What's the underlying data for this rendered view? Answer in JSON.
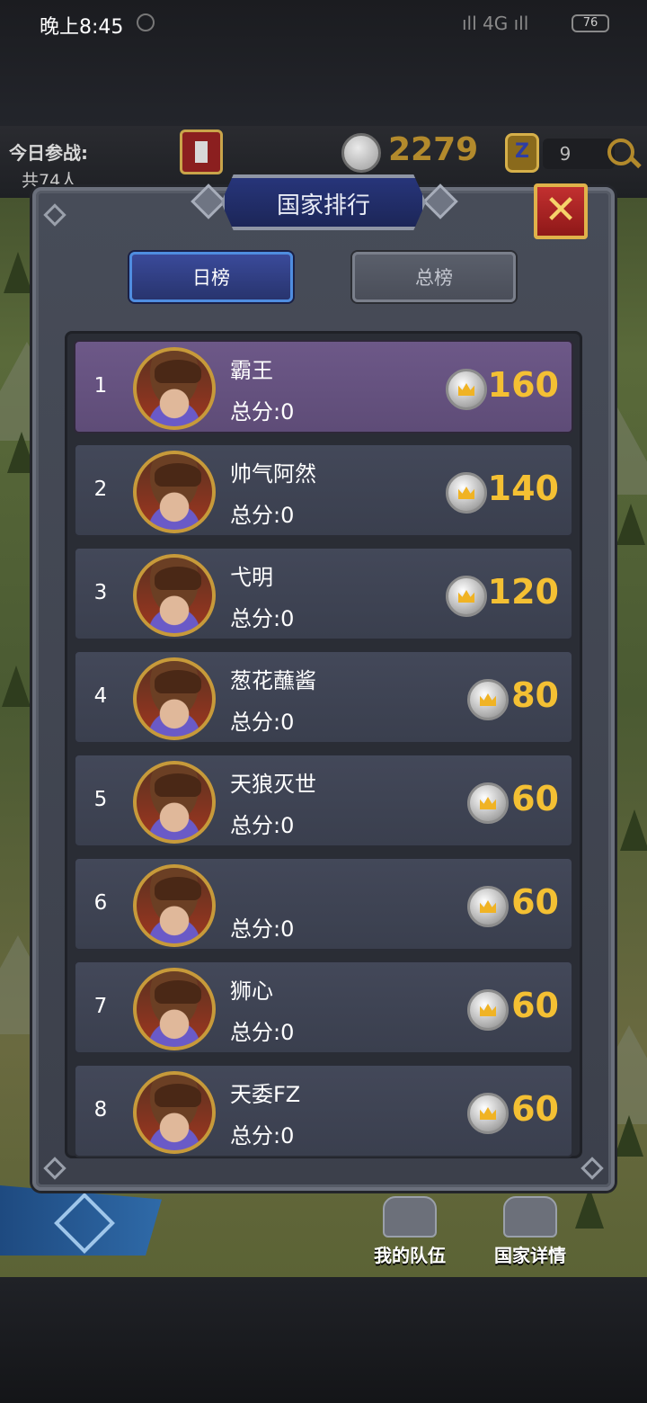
{
  "status_bar": {
    "time": "晚上8:45",
    "signal": "4G",
    "battery": "76"
  },
  "top_bar": {
    "joined_label": "今日参战:",
    "joined_count": "共74人",
    "score": "2279",
    "z_count": "9"
  },
  "panel": {
    "title": "国家排行",
    "close": "✕",
    "tabs": [
      {
        "label": "日榜",
        "active": true
      },
      {
        "label": "总榜",
        "active": false
      }
    ],
    "rows": [
      {
        "rank": "1",
        "name": "霸王",
        "total": "总分:0",
        "score": "160"
      },
      {
        "rank": "2",
        "name": "帅气阿然",
        "total": "总分:0",
        "score": "140"
      },
      {
        "rank": "3",
        "name": "弋明",
        "total": "总分:0",
        "score": "120"
      },
      {
        "rank": "4",
        "name": "葱花蘸酱",
        "total": "总分:0",
        "score": "80"
      },
      {
        "rank": "5",
        "name": "天狼灭世",
        "total": "总分:0",
        "score": "60"
      },
      {
        "rank": "6",
        "name": "",
        "total": "总分:0",
        "score": "60"
      },
      {
        "rank": "7",
        "name": "狮心",
        "total": "总分:0",
        "score": "60"
      },
      {
        "rank": "8",
        "name": "天委FZ",
        "total": "总分:0",
        "score": "60"
      }
    ]
  },
  "bottom_buttons": {
    "my_team": "我的队伍",
    "country_details": "国家详情"
  },
  "colors": {
    "score_gold": "#f4c033",
    "first_row": "#6d5888",
    "row": "#434859",
    "tab_active": "#28346e"
  }
}
